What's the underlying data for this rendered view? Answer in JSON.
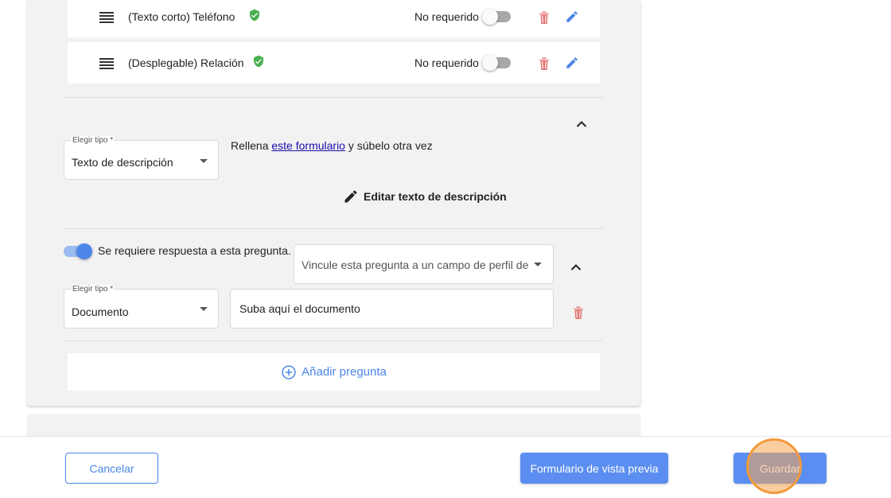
{
  "questions": [
    {
      "label": "(Texto corto) Teléfono",
      "required_label": "No requerido"
    },
    {
      "label": "(Desplegable) Relación",
      "required_label": "No requerido"
    }
  ],
  "description_block": {
    "type_label": "Elegir tipo *",
    "type_value": "Texto de descripción",
    "text_before": "Rellena ",
    "link_text": "este formulario",
    "text_after": " y súbelo otra vez",
    "edit_label": "Editar texto de descripción"
  },
  "document_block": {
    "required_toggle_label": "Se requiere respuesta a esta pregunta.",
    "link_field_placeholder": "Vincule esta pregunta a un campo de perfil de ...",
    "type_label": "Elegir tipo *",
    "type_value": "Documento",
    "question_text": "Suba aquí el documento"
  },
  "add_question_label": "Añadir pregunta",
  "footer": {
    "cancel_label": "Cancelar",
    "preview_label": "Formulario de vista previa",
    "save_label": "Guardar"
  },
  "colors": {
    "accent": "#5b8ef0",
    "verified_green": "#4caf50",
    "delete_red": "#e57373",
    "click_highlight": "#f29a3a"
  },
  "icons": [
    "drag-handle-icon",
    "verified-shield-icon",
    "trash-icon",
    "pencil-icon",
    "chevron-up-icon",
    "caret-down-icon",
    "add-circle-icon"
  ]
}
